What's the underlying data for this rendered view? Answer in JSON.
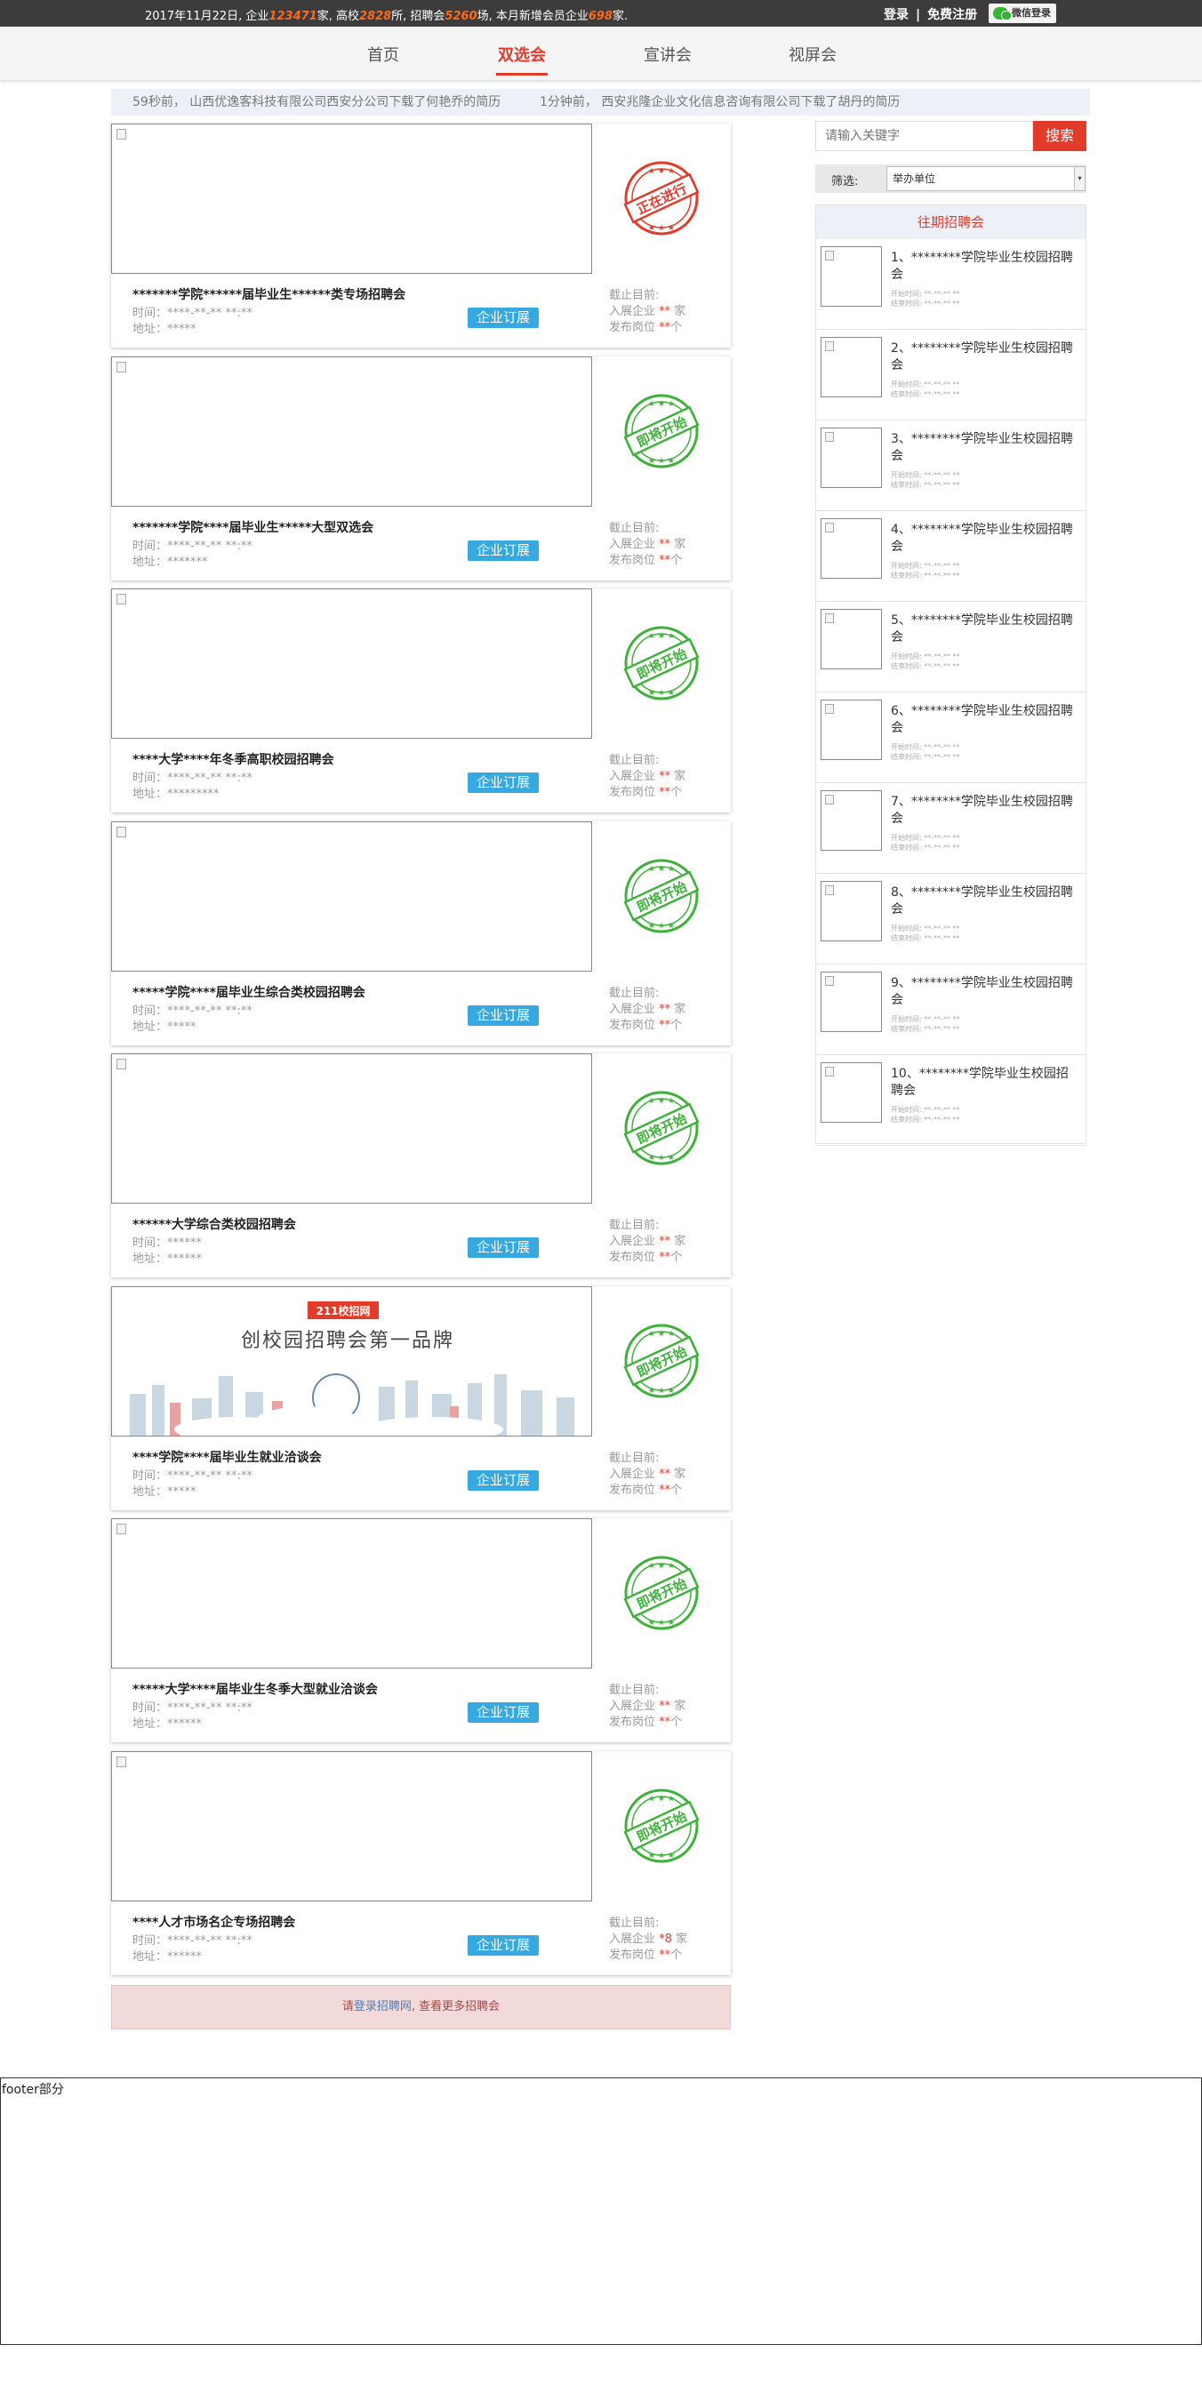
{
  "topbar": {
    "date_prefix": "2017年11月22日, 企业",
    "companies": "123471",
    "t1": "家, 高校",
    "universities": "2828",
    "t2": "所, 招聘会",
    "fairs": "5260",
    "t3": "场, 本月新增会员企业",
    "new_members": "698",
    "t4": "家.",
    "login": "登录",
    "sep": "|",
    "register": "免费注册",
    "wechat_login": "微信登录"
  },
  "nav": {
    "items": [
      {
        "label": "首页"
      },
      {
        "label": "双选会"
      },
      {
        "label": "宣讲会"
      },
      {
        "label": "视屏会"
      }
    ]
  },
  "ticker": [
    {
      "text": "59秒前， 山西优逸客科技有限公司西安分公司下载了何艳乔的简历"
    },
    {
      "text": "1分钟前， 西安兆隆企业文化信息咨询有限公司下载了胡丹的简历"
    }
  ],
  "stamp_text": {
    "ongoing": "正在进行",
    "upcoming": "即将开始"
  },
  "colors": {
    "accent": "#e23b2a",
    "ongoing_stamp": "#e23b2a",
    "upcoming_stamp": "#3fb23c",
    "button": "#36a9e1"
  },
  "card_labels": {
    "subscribe_btn": "企业订展",
    "deadline": "截止目前:",
    "ent_prefix": "入展企业",
    "pos_prefix": "发布岗位",
    "ent_unit": "家",
    "pos_unit": "个"
  },
  "fairs": [
    {
      "title": "*******学院******届毕业生******类专场招聘会",
      "time": "时间：****-**-** **:**",
      "addr": "地址：*****",
      "status": "ongoing",
      "ent_count": "**",
      "ent_unit": "家",
      "pos_count": "**",
      "has_image": false
    },
    {
      "title": "*******学院****届毕业生*****大型双选会",
      "time": "时间：****-**-** **:**",
      "addr": "地址：*******",
      "status": "upcoming",
      "ent_count": "**",
      "ent_unit": "家",
      "pos_count": "**",
      "has_image": false
    },
    {
      "title": "****大学****年冬季高职校园招聘会",
      "time": "时间：****-**-** **:**",
      "addr": "地址：*********",
      "status": "upcoming",
      "ent_count": "**",
      "ent_unit": "家",
      "pos_count": "**",
      "has_image": false
    },
    {
      "title": "*****学院****届毕业生综合类校园招聘会",
      "time": "时间：****-**-** **:**",
      "addr": "地址：*****",
      "status": "upcoming",
      "ent_count": "**",
      "ent_unit": "家",
      "pos_count": "**",
      "has_image": false
    },
    {
      "title": "******大学综合类校园招聘会",
      "time": "时间：******",
      "addr": "地址：******",
      "status": "upcoming",
      "ent_count": "**",
      "ent_unit": "家",
      "pos_count": "**",
      "has_image": false
    },
    {
      "title": "****学院****届毕业生就业洽谈会",
      "time": "时间：****-**-** **:**",
      "addr": "地址：*****",
      "status": "upcoming",
      "ent_count": "**",
      "ent_unit": "家",
      "pos_count": "**",
      "has_image": true
    },
    {
      "title": "*****大学****届毕业生冬季大型就业洽谈会",
      "time": "时间：****-**-** **:**",
      "addr": "地址：******",
      "status": "upcoming",
      "ent_count": "**",
      "ent_unit": "家",
      "pos_count": "**",
      "has_image": false
    },
    {
      "title": "****人才市场名企专场招聘会",
      "time": "时间：****-**-** **:**",
      "addr": "地址：******",
      "status": "upcoming",
      "ent_count": "*8",
      "ent_unit": "家",
      "pos_count": "**",
      "has_image": false
    }
  ],
  "ad_banner": {
    "logo_text": "211校招网",
    "slogan": "创校园招聘会第一品牌"
  },
  "more_bar": {
    "prefix": "请",
    "link": "登录招聘网",
    "suffix": ", 查看更多招聘会"
  },
  "search": {
    "placeholder": "请输入关键字",
    "button": "搜索"
  },
  "filter": {
    "label": "筛选:",
    "selected": "举办单位"
  },
  "past": {
    "title": "往期招聘会",
    "start_label": "开始时间: **-**-** **",
    "end_label": "结束时间: **-**-** **",
    "items": [
      {
        "label": "1、********学院毕业生校园招聘会"
      },
      {
        "label": "2、********学院毕业生校园招聘会"
      },
      {
        "label": "3、********学院毕业生校园招聘会"
      },
      {
        "label": "4、********学院毕业生校园招聘会"
      },
      {
        "label": "5、********学院毕业生校园招聘会"
      },
      {
        "label": "6、********学院毕业生校园招聘会"
      },
      {
        "label": "7、********学院毕业生校园招聘会"
      },
      {
        "label": "8、********学院毕业生校园招聘会"
      },
      {
        "label": "9、********学院毕业生校园招聘会"
      },
      {
        "label": "10、********学院毕业生校园招聘会"
      }
    ]
  },
  "footer": {
    "text": "footer部分"
  }
}
